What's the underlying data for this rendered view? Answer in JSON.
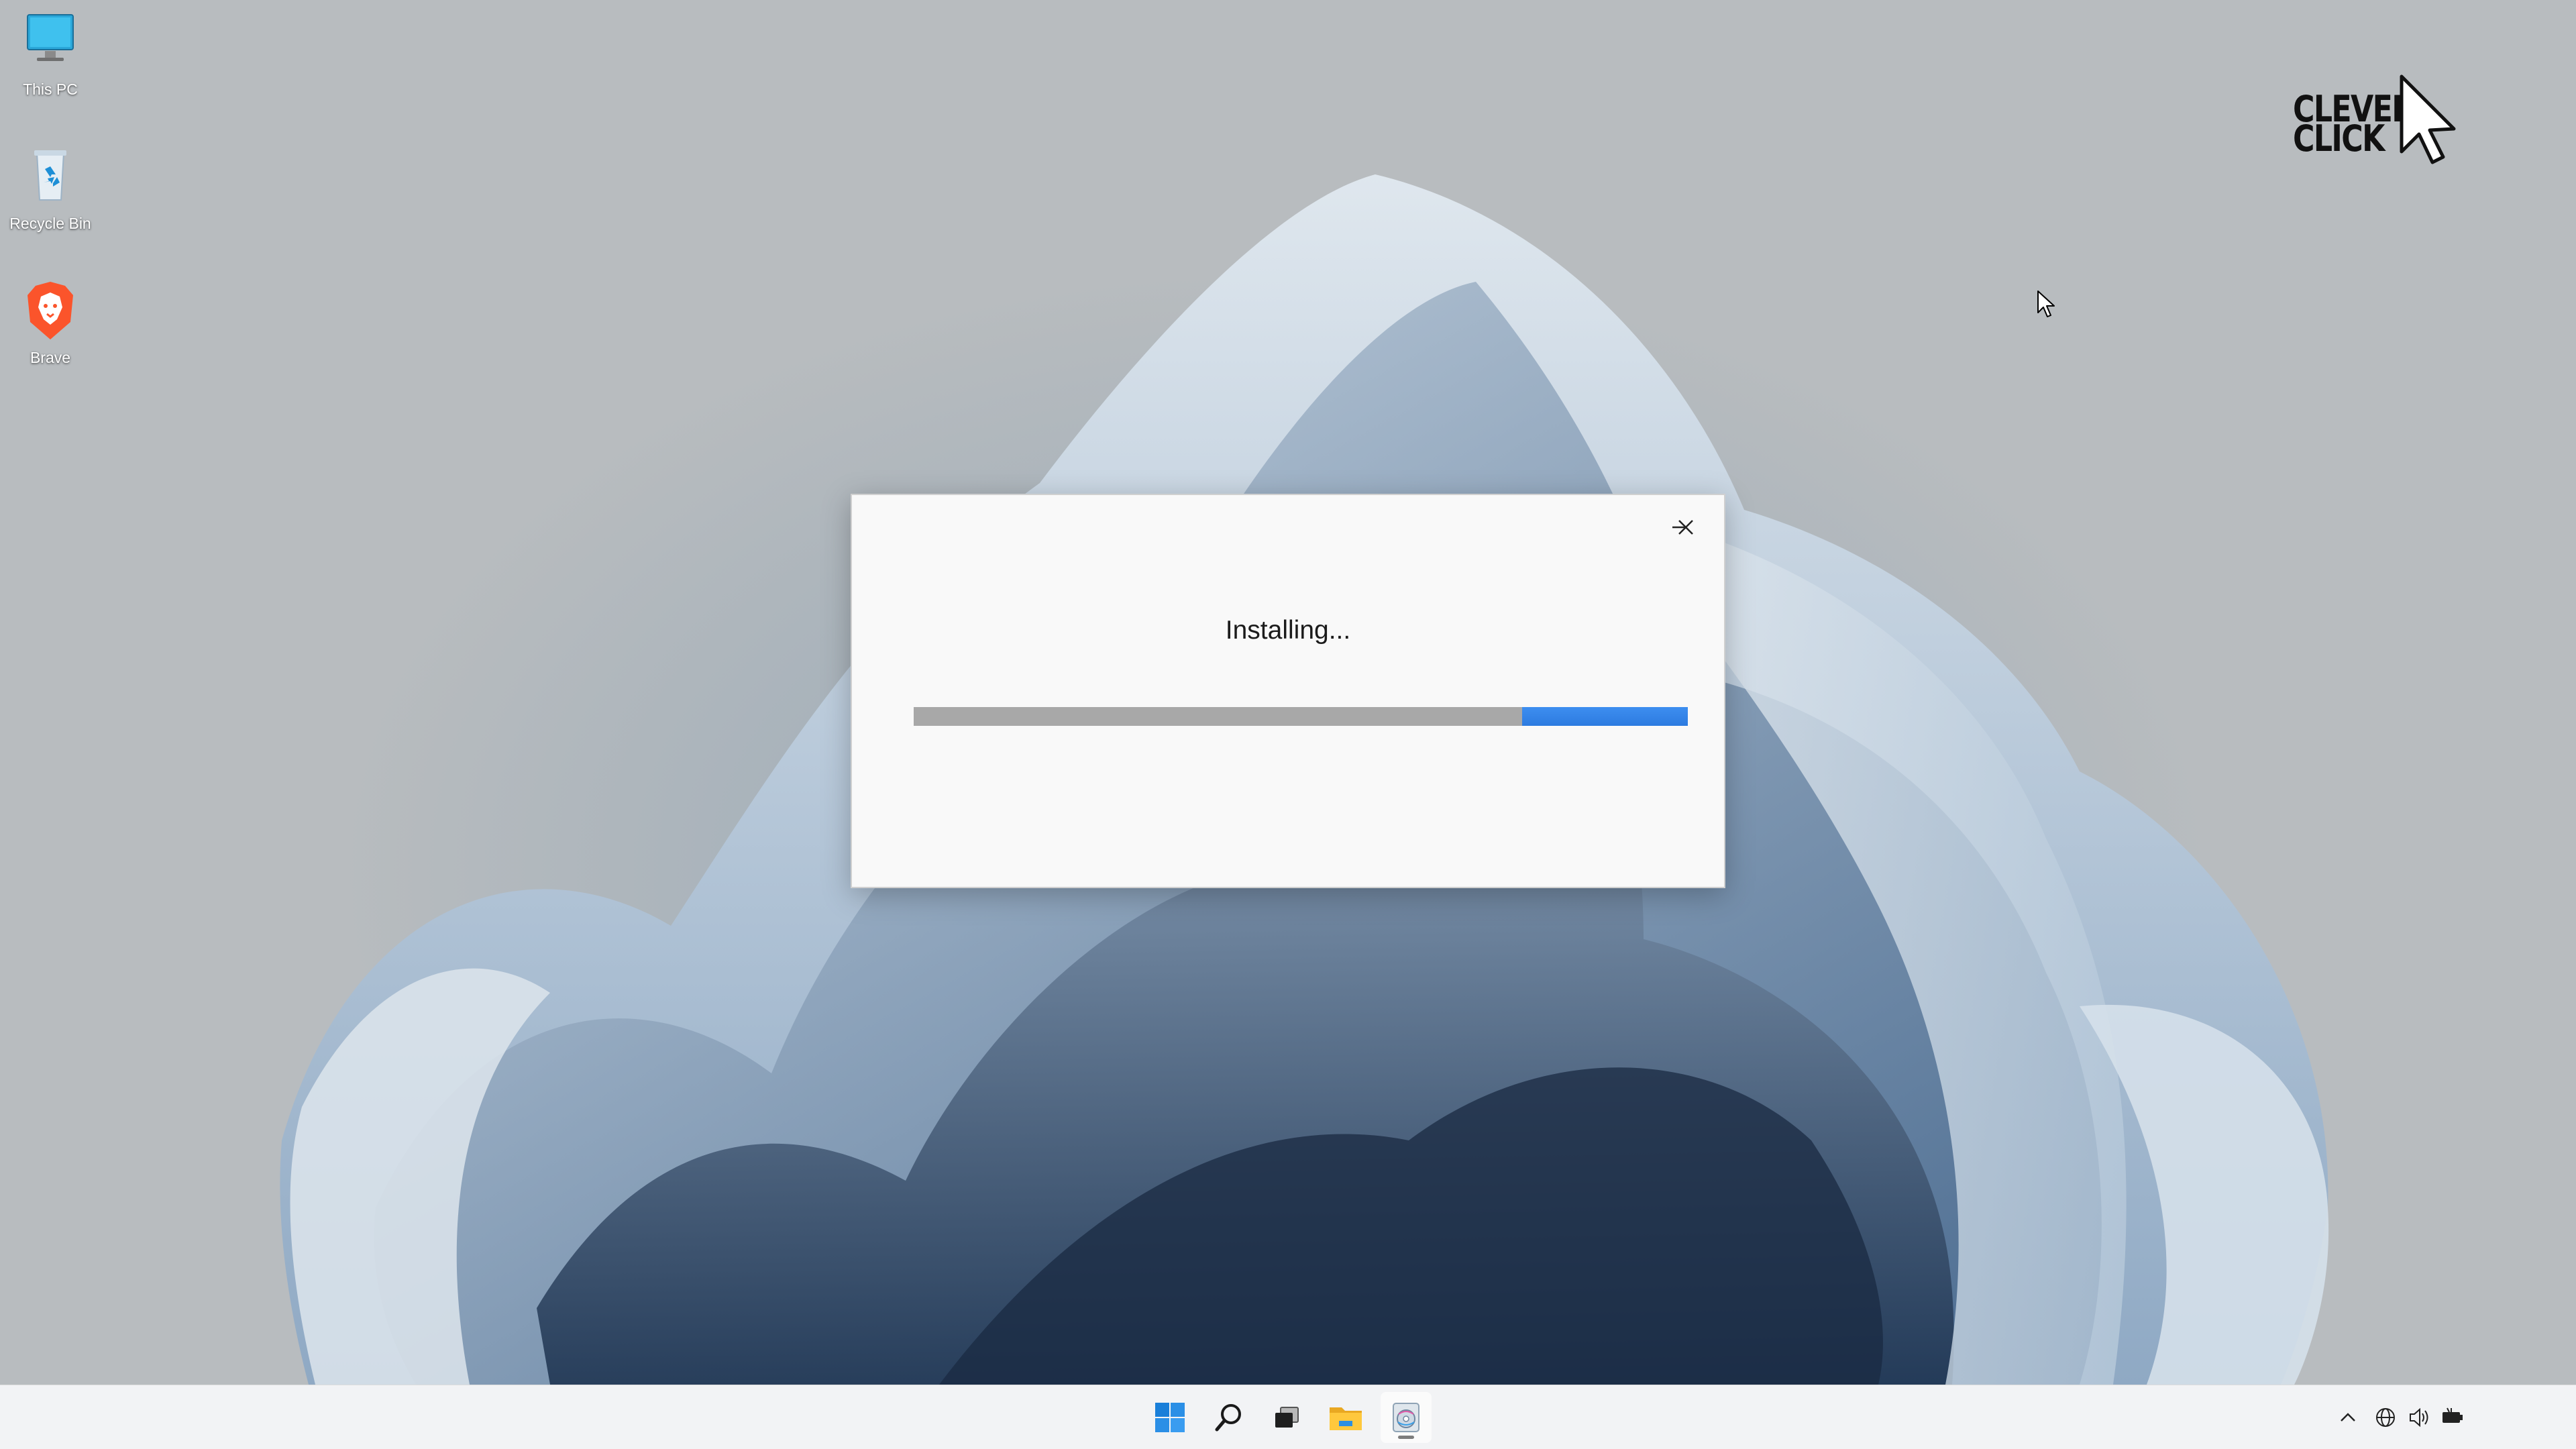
{
  "desktop": {
    "icons": [
      {
        "label": "This PC",
        "icon": "monitor-icon"
      },
      {
        "label": "Recycle Bin",
        "icon": "recycle-bin-icon"
      },
      {
        "label": "Brave",
        "icon": "brave-lion-icon"
      }
    ],
    "watermark": {
      "line1": "CLEVER",
      "line2": "CLICK",
      "icon": "cursor-arrow-icon"
    }
  },
  "dialog": {
    "status_text": "Installing...",
    "minimize_icon": "minimize-icon",
    "close_icon": "close-icon",
    "progress": {
      "filled_fraction": 0.19,
      "style": "indeterminate-marquee",
      "accent": "#2f80e8",
      "track": "#a8a8a8"
    }
  },
  "taskbar": {
    "items": [
      {
        "name": "start",
        "icon": "windows-logo-icon"
      },
      {
        "name": "search",
        "icon": "search-icon"
      },
      {
        "name": "task-view",
        "icon": "task-view-icon"
      },
      {
        "name": "file-explorer",
        "icon": "folder-icon"
      },
      {
        "name": "installer",
        "icon": "installer-disc-icon",
        "active": true
      }
    ],
    "tray": [
      "chevron-up-icon",
      "globe-icon",
      "speaker-icon",
      "battery-icon"
    ]
  },
  "colors": {
    "accent": "#2f80e8",
    "taskbar": "#f2f3f5",
    "dialog": "#f9f9f9"
  }
}
